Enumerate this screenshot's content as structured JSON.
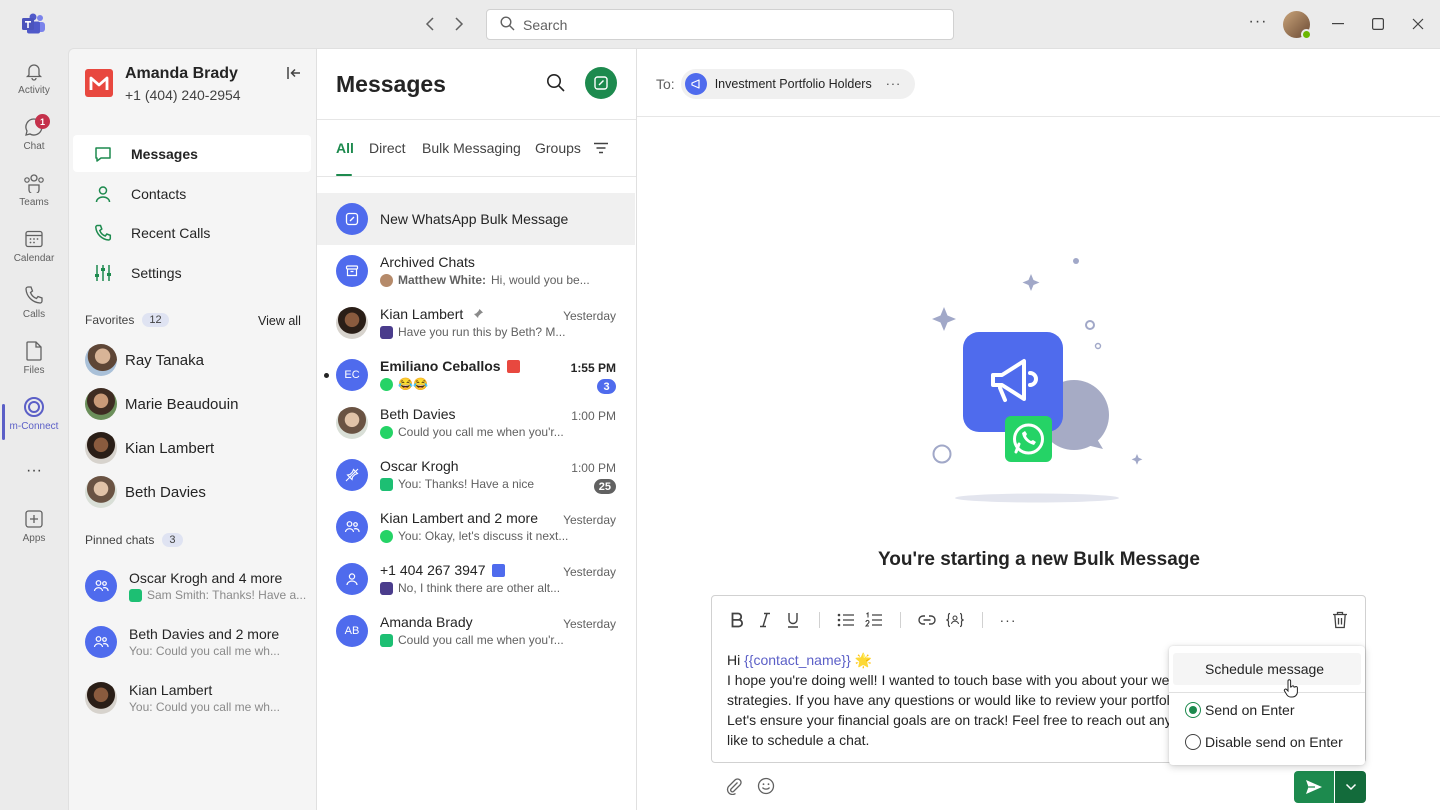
{
  "titlebar": {
    "search_placeholder": "Search",
    "more": "···",
    "window_controls": [
      "minimize",
      "maximize",
      "close"
    ]
  },
  "rail": {
    "items": [
      {
        "label": "Activity",
        "icon": "bell-icon"
      },
      {
        "label": "Chat",
        "icon": "chat-icon",
        "badge": "1"
      },
      {
        "label": "Teams",
        "icon": "teams-icon"
      },
      {
        "label": "Calendar",
        "icon": "calendar-icon"
      },
      {
        "label": "Calls",
        "icon": "phone-icon"
      },
      {
        "label": "Files",
        "icon": "file-icon"
      },
      {
        "label": "m-Connect",
        "icon": "m-connect-icon",
        "active": true
      },
      {
        "label": "···",
        "icon": "more-icon"
      },
      {
        "label": "Apps",
        "icon": "apps-icon"
      }
    ]
  },
  "left_panel": {
    "user_name": "Amanda Brady",
    "user_phone": "+1 (404) 240-2954",
    "nav": [
      "Messages",
      "Contacts",
      "Recent Calls",
      "Settings"
    ],
    "favorites_label": "Favorites",
    "favorites_count": "12",
    "view_all": "View all",
    "favorites": [
      "Ray Tanaka",
      "Marie Beaudouin",
      "Kian Lambert",
      "Beth Davies"
    ],
    "pinned_label": "Pinned chats",
    "pinned_count": "3",
    "pinned": [
      {
        "name": "Oscar Krogh and 4 more",
        "preview": "Sam Smith: Thanks! Have a..."
      },
      {
        "name": "Beth Davies and 2 more",
        "preview": "You: Could you call me wh..."
      },
      {
        "name": "Kian Lambert",
        "preview": "You: Could you call me wh..."
      }
    ]
  },
  "messages_panel": {
    "title": "Messages",
    "tabs": [
      "All",
      "Direct",
      "Bulk Messaging",
      "Groups"
    ],
    "conversations": [
      {
        "name": "New WhatsApp Bulk Message",
        "preview": "",
        "time": "",
        "badge": ""
      },
      {
        "name": "Archived Chats",
        "preview_sender": "Matthew White:",
        "preview": "Hi, would you be...",
        "time": "",
        "badge": ""
      },
      {
        "name": "Kian Lambert",
        "preview": "Have you run this by Beth? M...",
        "time": "Yesterday",
        "badge": ""
      },
      {
        "name": "Emiliano Ceballos",
        "initials": "EC",
        "preview": "😂😂",
        "time": "1:55 PM",
        "badge": "3"
      },
      {
        "name": "Beth Davies",
        "preview": "Could you call me when you'r...",
        "time": "1:00 PM",
        "badge": ""
      },
      {
        "name": "Oscar Krogh",
        "preview": "You: Thanks! Have a nice",
        "time": "1:00 PM",
        "badge": "25"
      },
      {
        "name": "Kian Lambert and 2 more",
        "preview": "You: Okay, let's discuss it next...",
        "time": "Yesterday",
        "badge": ""
      },
      {
        "name": "+1 404 267 3947",
        "preview": "No, I think there are other alt...",
        "time": "Yesterday",
        "badge": ""
      },
      {
        "name": "Amanda Brady",
        "initials": "AB",
        "preview": "Could you call me when you'r...",
        "time": "Yesterday",
        "badge": ""
      }
    ]
  },
  "main": {
    "to_label": "To:",
    "recipient": "Investment Portfolio Holders",
    "recipient_more": "···",
    "heading": "You're starting a new Bulk Message",
    "composer": {
      "line1_prefix": "Hi ",
      "token": "{{contact_name}}",
      "line1_emoji": "🌟",
      "line2": "I hope you're doing well! I wanted to touch base with you about your we",
      "line3": "strategies. If you have any questions or would like to review your portfol",
      "line4": "Let's ensure your financial goals are on track! Feel free to reach out anyt",
      "line5": "like to schedule a chat.",
      "more": "···"
    }
  },
  "send_menu": {
    "schedule": "Schedule message",
    "send_on_enter": "Send on Enter",
    "disable_send_on_enter": "Disable send on Enter",
    "selected": "Send on Enter"
  },
  "colors": {
    "accent_green": "#1d8a4e",
    "brand_purple": "#5b5fc7",
    "group_blue": "#4f6bed",
    "whatsapp_green": "#25d366",
    "badge_red": "#c4314b"
  }
}
